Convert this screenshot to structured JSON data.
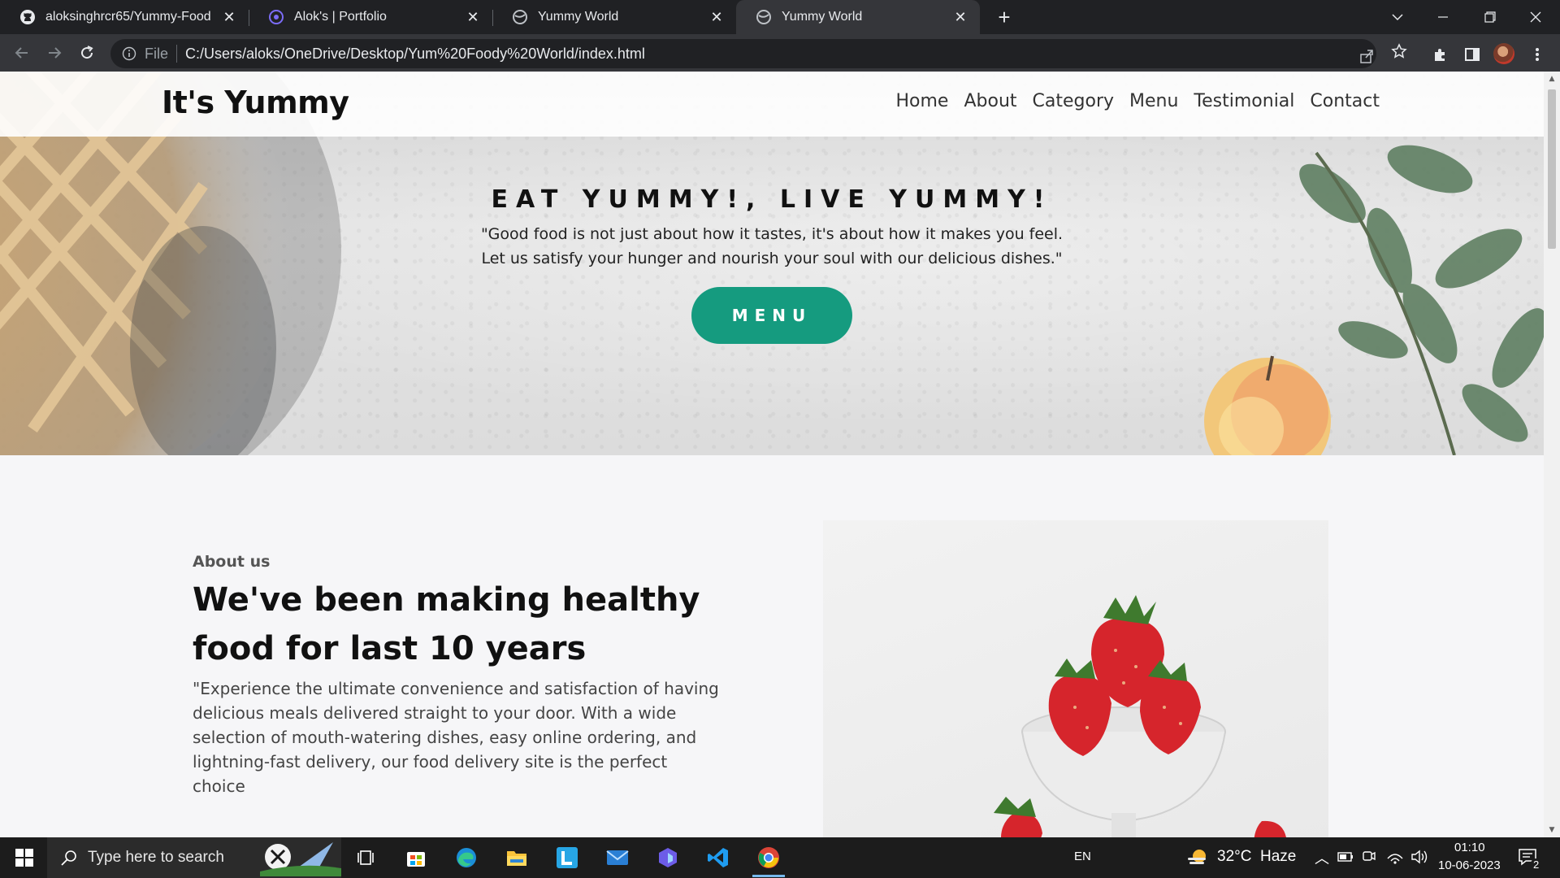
{
  "browser": {
    "tabs": [
      {
        "title": "aloksinghrcr65/Yummy-Food",
        "icon": "github-icon",
        "active": false
      },
      {
        "title": "Alok's | Portfolio",
        "icon": "portfolio-icon",
        "active": false
      },
      {
        "title": "Yummy World",
        "icon": "globe-icon",
        "active": false
      },
      {
        "title": "Yummy World",
        "icon": "globe-icon",
        "active": true
      }
    ],
    "new_tab": "+",
    "omnibox": {
      "scheme_label": "File",
      "url": "C:/Users/aloks/OneDrive/Desktop/Yum%20Foody%20World/index.html"
    }
  },
  "site": {
    "brand": "It's Yummy",
    "nav": [
      "Home",
      "About",
      "Category",
      "Menu",
      "Testimonial",
      "Contact"
    ],
    "hero": {
      "title": "EAT YUMMY!, LIVE YUMMY!",
      "quote_line1": "\"Good food is not just about how it tastes, it's about how it makes you feel.",
      "quote_line2": "Let us satisfy your hunger and nourish your soul with our delicious dishes.\"",
      "button": "MENU"
    },
    "about": {
      "eyebrow": "About us",
      "heading": "We've been making healthy food for last 10 years",
      "body": "\"Experience the ultimate convenience and satisfaction of having delicious meals delivered straight to your door. With a wide selection of mouth-watering dishes, easy online ordering, and lightning-fast delivery, our food delivery site is the perfect choice"
    },
    "colors": {
      "accent": "#159b7f"
    }
  },
  "taskbar": {
    "search_placeholder": "Type here to search",
    "language": "EN",
    "weather": "32°C  Haze",
    "time": "01:10",
    "date": "10-06-2023",
    "notification_count": "2",
    "apps": [
      "task-view-icon",
      "microsoft-store-icon",
      "edge-icon",
      "file-explorer-icon",
      "l-app-icon",
      "mail-icon",
      "copilot-icon",
      "vscode-icon",
      "chrome-icon"
    ]
  }
}
